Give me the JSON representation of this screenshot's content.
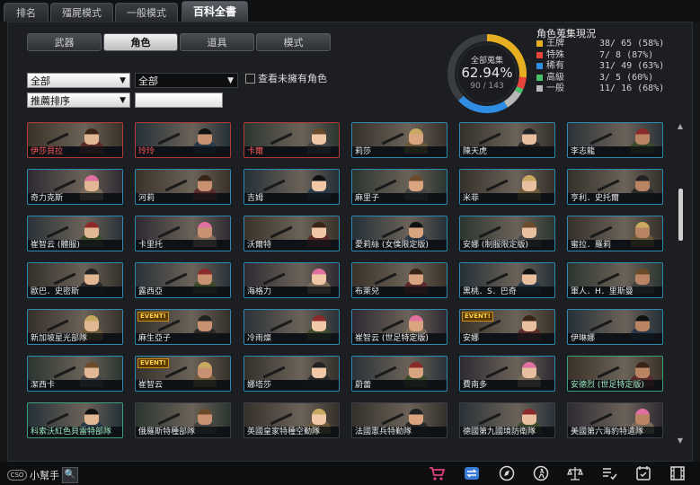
{
  "top_tabs": [
    "排名",
    "殭屍模式",
    "一般模式",
    "百科全書"
  ],
  "active_top_tab": "百科全書",
  "sub_tabs": [
    "武器",
    "角色",
    "道具",
    "模式"
  ],
  "active_sub_tab": "角色",
  "filters": {
    "category1": "全部",
    "category2": "全部",
    "sort": "推薦排序",
    "search_value": "",
    "show_unowned_label": "查看未擁有角色"
  },
  "collection": {
    "label": "全部蒐集",
    "percent": "62.94%",
    "fraction": "90 / 143",
    "percent_value": 62.94,
    "title": "角色蒐集現況",
    "stats": [
      {
        "name": "王牌",
        "value": "38/  65  (58%)",
        "color": "#e8b020",
        "fraction": 0.58
      },
      {
        "name": "特殊",
        "value": " 7/   8  (87%)",
        "color": "#e8443a",
        "fraction": 0.87
      },
      {
        "name": "稀有",
        "value": "31/  49  (63%)",
        "color": "#2f8de4",
        "fraction": 0.63
      },
      {
        "name": "高級",
        "value": " 3/   5  (60%)",
        "color": "#49c26b",
        "fraction": 0.6
      },
      {
        "name": "一般",
        "value": "11/  16  (68%)",
        "color": "#b8b8b8",
        "fraction": 0.68
      }
    ]
  },
  "characters": [
    {
      "name": "伊莎貝拉",
      "frame": "red",
      "event": false
    },
    {
      "name": "玲玲",
      "frame": "red",
      "event": false
    },
    {
      "name": "卡爾",
      "frame": "red",
      "event": false
    },
    {
      "name": "莉莎",
      "frame": "blue",
      "event": false
    },
    {
      "name": "陳天虎",
      "frame": "blue",
      "event": false
    },
    {
      "name": "李志龍",
      "frame": "blue",
      "event": false
    },
    {
      "name": "奇力克斯",
      "frame": "blue",
      "event": false
    },
    {
      "name": "河莉",
      "frame": "blue",
      "event": false
    },
    {
      "name": "吉姆",
      "frame": "blue",
      "event": false
    },
    {
      "name": "麻里子",
      "frame": "blue",
      "event": false
    },
    {
      "name": "米菲",
      "frame": "blue",
      "event": false
    },
    {
      "name": "亨利．史托爾",
      "frame": "blue",
      "event": false
    },
    {
      "name": "崔智云 (體服)",
      "frame": "blue",
      "event": false
    },
    {
      "name": "卡里托",
      "frame": "blue",
      "event": false
    },
    {
      "name": "沃爾特",
      "frame": "blue",
      "event": false
    },
    {
      "name": "愛莉絲 (女僕限定版)",
      "frame": "blue",
      "event": false
    },
    {
      "name": "安娜 (制服限定版)",
      "frame": "blue",
      "event": false
    },
    {
      "name": "蜜拉．羅莉",
      "frame": "blue",
      "event": false
    },
    {
      "name": "歐巴．史密斯",
      "frame": "blue",
      "event": false
    },
    {
      "name": "露西亞",
      "frame": "blue",
      "event": false
    },
    {
      "name": "海格力",
      "frame": "blue",
      "event": false
    },
    {
      "name": "布萊兒",
      "frame": "blue",
      "event": false
    },
    {
      "name": "黑桃．S．巴奇",
      "frame": "blue",
      "event": false
    },
    {
      "name": "軍人．H．里斯曼",
      "frame": "blue",
      "event": false
    },
    {
      "name": "新加坡星光部隊",
      "frame": "blue",
      "event": false
    },
    {
      "name": "麻生亞子",
      "frame": "blue",
      "event": true
    },
    {
      "name": "冷雨燦",
      "frame": "blue",
      "event": false
    },
    {
      "name": "崔智云 (世足特定版)",
      "frame": "blue",
      "event": false
    },
    {
      "name": "安娜",
      "frame": "blue",
      "event": true
    },
    {
      "name": "伊琳娜",
      "frame": "blue",
      "event": false
    },
    {
      "name": "潔西卡",
      "frame": "blue",
      "event": false
    },
    {
      "name": "崔智云",
      "frame": "blue",
      "event": true
    },
    {
      "name": "娜塔莎",
      "frame": "blue",
      "event": false
    },
    {
      "name": "蔚蕾",
      "frame": "blue",
      "event": false
    },
    {
      "name": "費南多",
      "frame": "blue",
      "event": false
    },
    {
      "name": "安德烈 (世足特定版)",
      "frame": "teal",
      "event": false
    },
    {
      "name": "科索沃紅色貝雷特部隊",
      "frame": "teal",
      "event": false
    },
    {
      "name": "俄羅斯特種部隊",
      "frame": "none",
      "event": false
    },
    {
      "name": "英國皇家特種空勤隊",
      "frame": "none",
      "event": false
    },
    {
      "name": "法國憲兵特勤隊",
      "frame": "none",
      "event": false
    },
    {
      "name": "德國第九國境防衛隊",
      "frame": "none",
      "event": false
    },
    {
      "name": "美國第六海豹特遣隊",
      "frame": "none",
      "event": false
    }
  ],
  "event_label": "EVENT!",
  "helper": {
    "badge": "CSO",
    "label": "小幫手"
  },
  "bottom_icons": [
    "shop-cart-icon",
    "swap-icon",
    "compass-icon",
    "runner-icon",
    "scales-icon",
    "list-check-icon",
    "calendar-check-icon",
    "film-icon"
  ],
  "colors": {
    "accent": "#2c8ab0",
    "rare_red": "#b43a3a",
    "teal": "#3aa07a",
    "event": "#ffd24a",
    "icon_pink": "#e0407a",
    "icon_blue": "#3a7bd5"
  }
}
